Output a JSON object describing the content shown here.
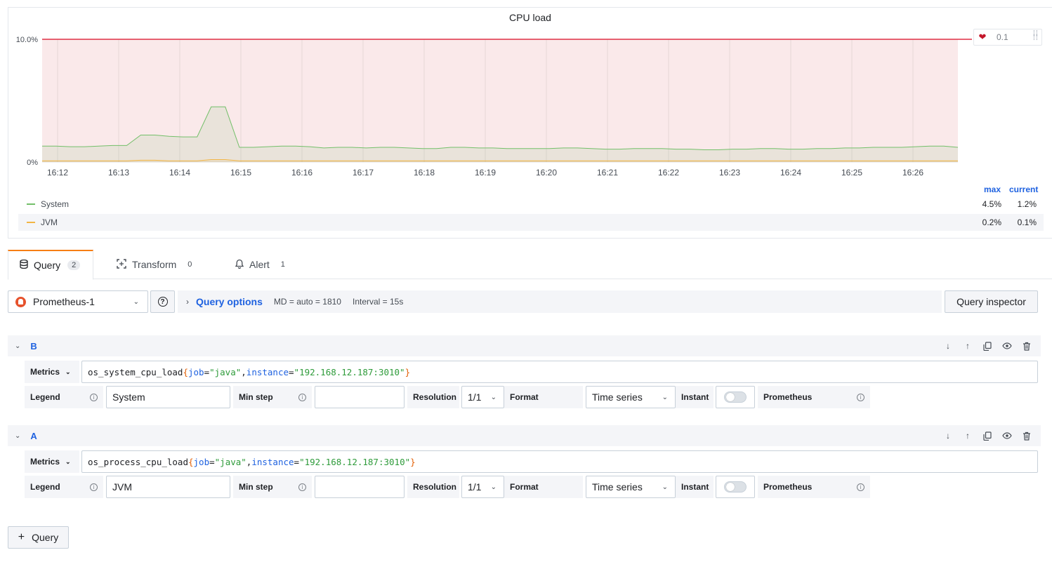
{
  "panel": {
    "title": "CPU load",
    "threshold_value": "0.1",
    "legend": {
      "headers": [
        "max",
        "current"
      ],
      "rows": [
        {
          "name": "System",
          "color": "#73bf69",
          "max": "4.5%",
          "current": "1.2%"
        },
        {
          "name": "JVM",
          "color": "#f2b544",
          "max": "0.2%",
          "current": "0.1%"
        }
      ]
    }
  },
  "chart_data": {
    "type": "line",
    "title": "CPU load",
    "y_tick_labels": [
      "10.0%",
      "0%"
    ],
    "ylim": [
      0,
      10
    ],
    "x_tick_labels": [
      "16:12",
      "16:13",
      "16:14",
      "16:15",
      "16:16",
      "16:17",
      "16:18",
      "16:19",
      "16:20",
      "16:21",
      "16:22",
      "16:23",
      "16:24",
      "16:25",
      "16:26"
    ],
    "threshold": {
      "value": 0.1,
      "color": "#e02f44",
      "fill": "#fae9ea"
    },
    "series": [
      {
        "name": "System",
        "color": "#73bf69",
        "values": [
          1.3,
          1.3,
          1.25,
          1.25,
          1.3,
          1.35,
          1.35,
          2.2,
          2.2,
          2.1,
          2.05,
          2.05,
          4.5,
          4.5,
          1.2,
          1.2,
          1.25,
          1.3,
          1.3,
          1.25,
          1.15,
          1.2,
          1.2,
          1.15,
          1.2,
          1.2,
          1.15,
          1.1,
          1.1,
          1.2,
          1.2,
          1.15,
          1.15,
          1.1,
          1.1,
          1.1,
          1.1,
          1.15,
          1.15,
          1.1,
          1.05,
          1.05,
          1.1,
          1.1,
          1.1,
          1.05,
          1.05,
          1.0,
          1.0,
          1.05,
          1.05,
          1.1,
          1.1,
          1.05,
          1.05,
          1.1,
          1.1,
          1.15,
          1.15,
          1.2,
          1.2,
          1.2,
          1.25,
          1.3,
          1.3,
          1.2
        ]
      },
      {
        "name": "JVM",
        "color": "#f2b544",
        "values": [
          0.1,
          0.1,
          0.1,
          0.1,
          0.1,
          0.1,
          0.1,
          0.15,
          0.15,
          0.1,
          0.1,
          0.1,
          0.2,
          0.2,
          0.1,
          0.1,
          0.1,
          0.1,
          0.1,
          0.1,
          0.1,
          0.1,
          0.1,
          0.1,
          0.1,
          0.1,
          0.1,
          0.1,
          0.1,
          0.1,
          0.1,
          0.1,
          0.1,
          0.1,
          0.1,
          0.1,
          0.1,
          0.1,
          0.1,
          0.1,
          0.1,
          0.1,
          0.1,
          0.1,
          0.1,
          0.1,
          0.1,
          0.1,
          0.1,
          0.1,
          0.1,
          0.1,
          0.1,
          0.1,
          0.1,
          0.1,
          0.1,
          0.1,
          0.1,
          0.1,
          0.1,
          0.1,
          0.1,
          0.1,
          0.1,
          0.1
        ]
      }
    ]
  },
  "tabs": [
    {
      "label": "Query",
      "count": "2",
      "icon": "database-icon"
    },
    {
      "label": "Transform",
      "count": "0",
      "icon": "transform-icon"
    },
    {
      "label": "Alert",
      "count": "1",
      "icon": "bell-icon"
    }
  ],
  "toolbar": {
    "datasource": "Prometheus-1",
    "query_options_label": "Query options",
    "md_info": "MD = auto = 1810",
    "interval_info": "Interval = 15s",
    "inspector_label": "Query inspector"
  },
  "queries": [
    {
      "ref": "B",
      "metrics_label": "Metrics",
      "expr": {
        "metric": "os_system_cpu_load",
        "lb": "{",
        "k1": "job",
        "eq1": "=",
        "v1": "\"java\"",
        "comma": ",",
        "k2": "instance",
        "eq2": "=",
        "v2": "\"192.168.12.187:3010\"",
        "rb": "}"
      },
      "legend_label": "Legend",
      "legend_value": "System",
      "minstep_label": "Min step",
      "minstep_value": "",
      "resolution_label": "Resolution",
      "resolution_value": "1/1",
      "format_label": "Format",
      "format_value": "Time series",
      "instant_label": "Instant",
      "prometheus_label": "Prometheus"
    },
    {
      "ref": "A",
      "metrics_label": "Metrics",
      "expr": {
        "metric": "os_process_cpu_load",
        "lb": "{",
        "k1": "job",
        "eq1": "=",
        "v1": "\"java\"",
        "comma": ",",
        "k2": "instance",
        "eq2": "=",
        "v2": "\"192.168.12.187:3010\"",
        "rb": "}"
      },
      "legend_label": "Legend",
      "legend_value": "JVM",
      "minstep_label": "Min step",
      "minstep_value": "",
      "resolution_label": "Resolution",
      "resolution_value": "1/1",
      "format_label": "Format",
      "format_value": "Time series",
      "instant_label": "Instant",
      "prometheus_label": "Prometheus"
    }
  ],
  "add_query_label": "Query"
}
